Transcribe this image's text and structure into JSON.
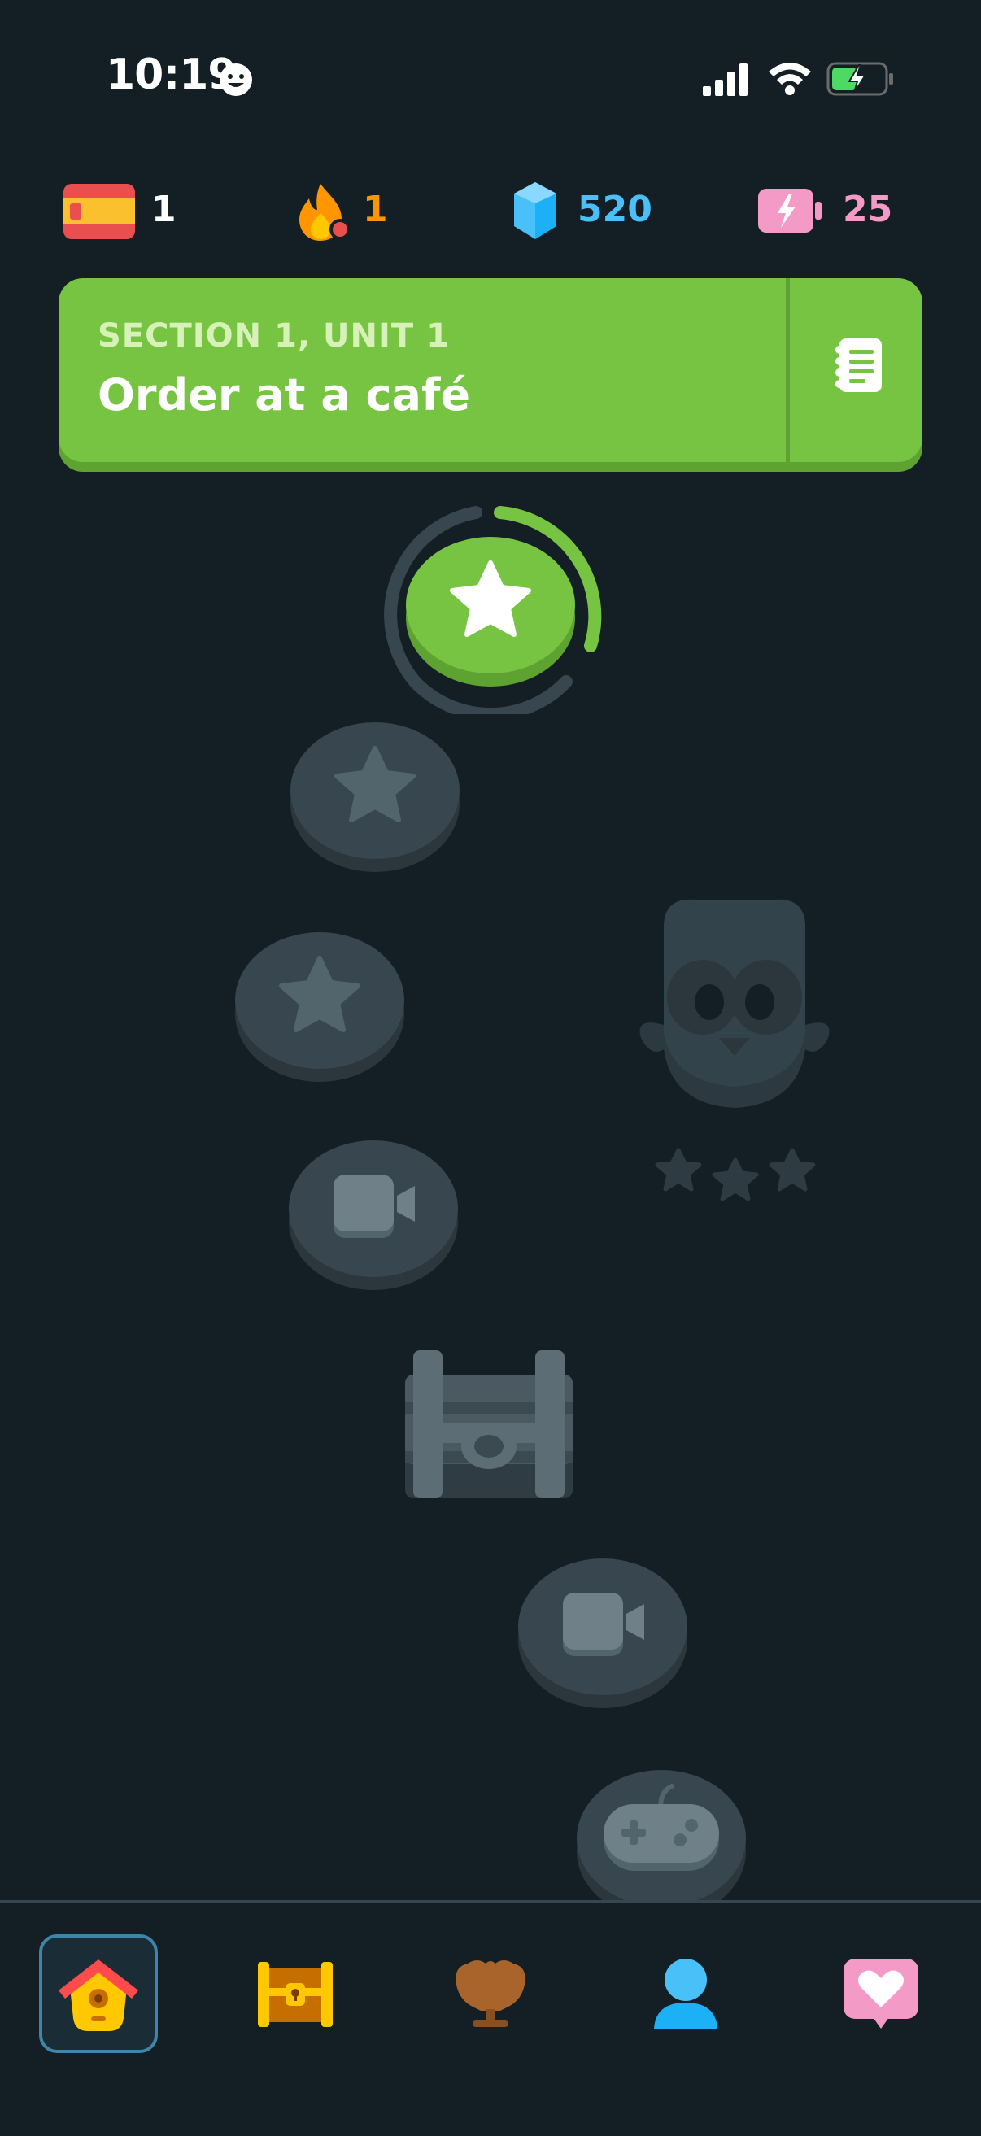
{
  "status_bar": {
    "time": "10:19"
  },
  "stats": {
    "course": {
      "flag": "spanish-flag-icon",
      "value": "1"
    },
    "streak": {
      "icon": "flame-icon",
      "value": "1",
      "color": "#ff9600"
    },
    "gems": {
      "icon": "gem-icon",
      "value": "520",
      "color": "#49c0f8"
    },
    "energy": {
      "icon": "energy-battery-icon",
      "value": "25",
      "color": "#f49ac6"
    }
  },
  "unit_banner": {
    "section_label": "SECTION 1, UNIT 1",
    "title": "Order at a café",
    "color": "#77c442",
    "guidebook_icon": "notebook-icon"
  },
  "path_nodes": [
    {
      "type": "star",
      "state": "active",
      "icon": "star-icon"
    },
    {
      "type": "star",
      "state": "locked",
      "icon": "star-icon"
    },
    {
      "type": "star",
      "state": "locked",
      "icon": "star-icon"
    },
    {
      "type": "video",
      "state": "locked",
      "icon": "video-camera-icon"
    },
    {
      "type": "chest",
      "state": "locked",
      "icon": "treasure-chest-icon"
    },
    {
      "type": "video",
      "state": "locked",
      "icon": "video-camera-icon"
    },
    {
      "type": "game",
      "state": "locked",
      "icon": "gamepad-icon"
    }
  ],
  "mascot": {
    "icon": "owl-mascot-icon",
    "stars": 3
  },
  "tabs": [
    {
      "name": "home",
      "icon": "home-icon",
      "active": true
    },
    {
      "name": "chests",
      "icon": "treasure-chest-icon",
      "active": false
    },
    {
      "name": "leaderboard",
      "icon": "trophy-icon",
      "active": false
    },
    {
      "name": "profile",
      "icon": "profile-icon",
      "active": false
    },
    {
      "name": "friends",
      "icon": "heart-chat-icon",
      "active": false
    }
  ],
  "colors": {
    "background": "#131f24",
    "locked_node": "#37464f",
    "locked_glyph": "#52656d",
    "accent_green": "#77c442"
  }
}
